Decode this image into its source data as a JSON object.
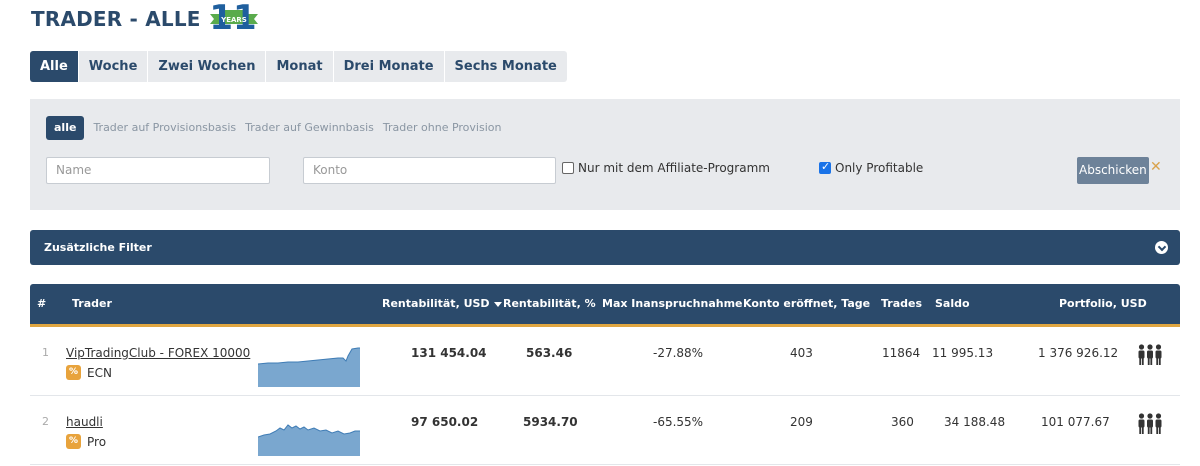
{
  "header": {
    "title": "TRADER - ALLE",
    "logo_number": "11",
    "logo_text": "YEARS"
  },
  "period_tabs": [
    {
      "label": "Alle",
      "active": true
    },
    {
      "label": "Woche"
    },
    {
      "label": "Zwei Wochen"
    },
    {
      "label": "Monat"
    },
    {
      "label": "Drei Monate"
    },
    {
      "label": "Sechs Monate"
    }
  ],
  "filters": {
    "type_tabs": [
      {
        "label": "alle",
        "active": true
      },
      {
        "label": "Trader auf Provisionsbasis"
      },
      {
        "label": "Trader auf Gewinnbasis"
      },
      {
        "label": "Trader ohne Provision"
      }
    ],
    "name_placeholder": "Name",
    "konto_placeholder": "Konto",
    "affiliate_label": "Nur mit dem Affiliate-Programm",
    "affiliate_checked": false,
    "profitable_label": "Only Profitable",
    "profitable_checked": true,
    "submit_label": "Abschicken",
    "clear_glyph": "✕"
  },
  "extra_filter_label": "Zusätzliche Filter",
  "table": {
    "columns": {
      "rank": "#",
      "trader": "Trader",
      "rent_usd": "Rentabilität, USD",
      "rent_pct": "Rentabilität, %",
      "drawdown": "Max Inanspruchnahme",
      "days": "Konto eröffnet, Tage",
      "trades": "Trades",
      "saldo": "Saldo",
      "portfolio": "Portfolio, USD"
    },
    "rows": [
      {
        "rank": "1",
        "name": "VipTradingClub - FOREX 10000",
        "badge": "%",
        "account_type": "ECN",
        "rent_usd": "131 454.04",
        "rent_pct": "563.46",
        "drawdown": "-27.88%",
        "days": "403",
        "trades": "11864",
        "saldo": "11 995.13",
        "portfolio": "1 376 926.12"
      },
      {
        "rank": "2",
        "name": "haudli",
        "badge": "%",
        "account_type": "Pro",
        "rent_usd": "97 650.02",
        "rent_pct": "5934.70",
        "drawdown": "-65.55%",
        "days": "209",
        "trades": "360",
        "saldo": "34 188.48",
        "portfolio": "101 077.67"
      }
    ]
  },
  "colors": {
    "primary": "#2b4a6b",
    "accent": "#e0a641",
    "filter_bg": "#e8eaed",
    "sparkline_fill": "#7aa7cf",
    "sparkline_line": "#3f7cb5"
  }
}
